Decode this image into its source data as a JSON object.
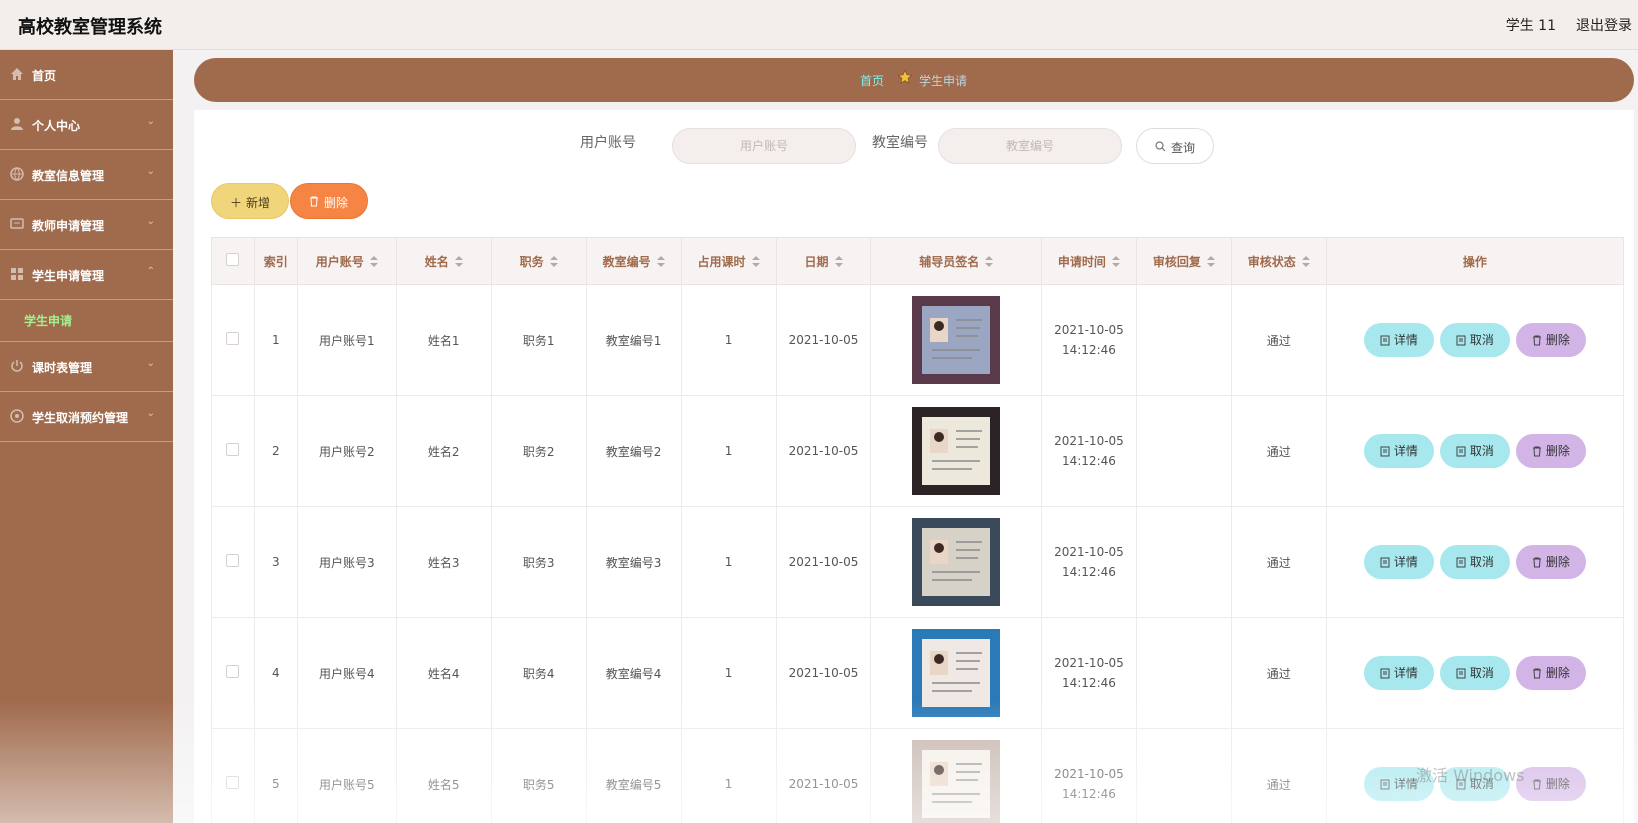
{
  "header": {
    "title": "高校教室管理系统",
    "user": "学生 11",
    "logout": "退出登录"
  },
  "sidebar": {
    "items": [
      {
        "label": "首页",
        "icon": "home-icon"
      },
      {
        "label": "个人中心",
        "icon": "user-icon"
      },
      {
        "label": "教室信息管理",
        "icon": "globe-icon"
      },
      {
        "label": "教师申请管理",
        "icon": "message-icon"
      },
      {
        "label": "学生申请管理",
        "icon": "grid-icon"
      },
      {
        "label": "课时表管理",
        "icon": "power-icon"
      },
      {
        "label": "学生取消预约管理",
        "icon": "compass-icon"
      }
    ],
    "active_sub": "学生申请"
  },
  "breadcrumb": {
    "home": "首页",
    "current": "学生申请"
  },
  "search": {
    "account_label": "用户账号",
    "account_placeholder": "用户账号",
    "room_label": "教室编号",
    "room_placeholder": "教室编号",
    "query": "查询"
  },
  "actions": {
    "add": "新增",
    "delete": "删除"
  },
  "table": {
    "headers": [
      "索引",
      "用户账号",
      "姓名",
      "职务",
      "教室编号",
      "占用课时",
      "日期",
      "辅导员签名",
      "申请时间",
      "审核回复",
      "审核状态",
      "操作"
    ],
    "rows": [
      {
        "index": "1",
        "account": "用户账号1",
        "name": "姓名1",
        "duty": "职务1",
        "room": "教室编号1",
        "hours": "1",
        "date": "2021-10-05",
        "time_date": "2021-10-05",
        "time_clock": "14:12:46",
        "reply": "",
        "status": "通过"
      },
      {
        "index": "2",
        "account": "用户账号2",
        "name": "姓名2",
        "duty": "职务2",
        "room": "教室编号2",
        "hours": "1",
        "date": "2021-10-05",
        "time_date": "2021-10-05",
        "time_clock": "14:12:46",
        "reply": "",
        "status": "通过"
      },
      {
        "index": "3",
        "account": "用户账号3",
        "name": "姓名3",
        "duty": "职务3",
        "room": "教室编号3",
        "hours": "1",
        "date": "2021-10-05",
        "time_date": "2021-10-05",
        "time_clock": "14:12:46",
        "reply": "",
        "status": "通过"
      },
      {
        "index": "4",
        "account": "用户账号4",
        "name": "姓名4",
        "duty": "职务4",
        "room": "教室编号4",
        "hours": "1",
        "date": "2021-10-05",
        "time_date": "2021-10-05",
        "time_clock": "14:12:46",
        "reply": "",
        "status": "通过"
      },
      {
        "index": "5",
        "account": "用户账号5",
        "name": "姓名5",
        "duty": "职务5",
        "room": "教室编号5",
        "hours": "1",
        "date": "2021-10-05",
        "time_date": "2021-10-05",
        "time_clock": "14:12:46",
        "reply": "",
        "status": "通过"
      }
    ],
    "row_actions": {
      "detail": "详情",
      "cancel": "取消",
      "delete": "删除"
    }
  },
  "watermark": "激活 Windows",
  "colors": {
    "sidebar": "#a06a4c",
    "accent_green": "#9ff38f",
    "add_button": "#f1d57a",
    "delete_button": "#f58445",
    "detail_button": "#a6e8ee",
    "row_delete_button": "#d2b4e6"
  }
}
